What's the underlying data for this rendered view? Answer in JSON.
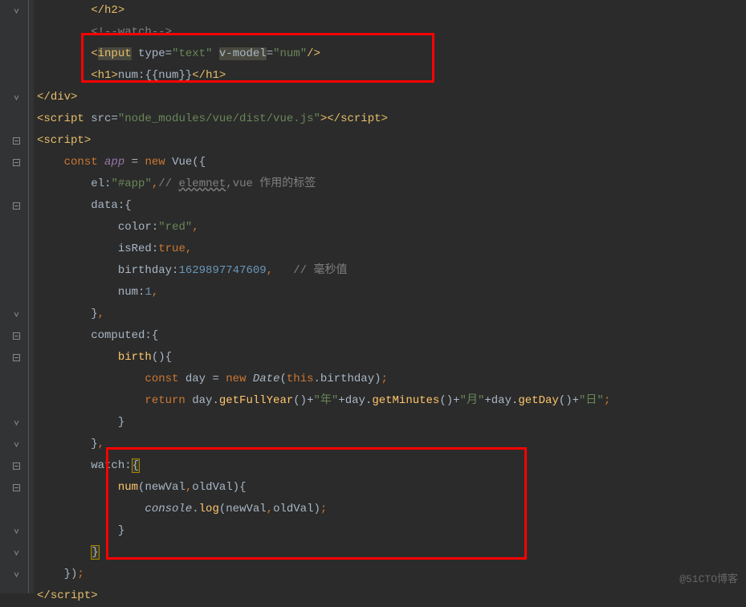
{
  "watermark": "@51CTO博客",
  "lines": [
    {
      "indent": 2,
      "tokens": [
        {
          "t": "</",
          "c": "tag"
        },
        {
          "t": "h2",
          "c": "tag"
        },
        {
          "t": ">",
          "c": "tag"
        }
      ]
    },
    {
      "indent": 2,
      "tokens": [
        {
          "t": "<!--watch-->",
          "c": "comment"
        }
      ]
    },
    {
      "indent": 2,
      "tokens": [
        {
          "t": "<",
          "c": "tag"
        },
        {
          "t": "input",
          "c": "tag hl1"
        },
        {
          "t": " ",
          "c": ""
        },
        {
          "t": "type=",
          "c": "attr"
        },
        {
          "t": "\"text\"",
          "c": "string"
        },
        {
          "t": " ",
          "c": ""
        },
        {
          "t": "v-model",
          "c": "attr hl1"
        },
        {
          "t": "=",
          "c": "attr"
        },
        {
          "t": "\"num\"",
          "c": "string"
        },
        {
          "t": "/>",
          "c": "tag"
        }
      ]
    },
    {
      "indent": 2,
      "tokens": [
        {
          "t": "<",
          "c": "tag"
        },
        {
          "t": "h1",
          "c": "tag"
        },
        {
          "t": ">",
          "c": "tag"
        },
        {
          "t": "num:{{num}}",
          "c": "text"
        },
        {
          "t": "</",
          "c": "tag"
        },
        {
          "t": "h1",
          "c": "tag"
        },
        {
          "t": ">",
          "c": "tag"
        }
      ]
    },
    {
      "indent": 0,
      "tokens": [
        {
          "t": "</",
          "c": "tag"
        },
        {
          "t": "div",
          "c": "tag"
        },
        {
          "t": ">",
          "c": "tag"
        }
      ]
    },
    {
      "indent": 0,
      "tokens": [
        {
          "t": "<",
          "c": "tag"
        },
        {
          "t": "script ",
          "c": "tag"
        },
        {
          "t": "src=",
          "c": "attr"
        },
        {
          "t": "\"node_modules/vue/dist/vue.js\"",
          "c": "string"
        },
        {
          "t": "></",
          "c": "tag"
        },
        {
          "t": "script",
          "c": "tag"
        },
        {
          "t": ">",
          "c": "tag"
        }
      ]
    },
    {
      "indent": 0,
      "tokens": [
        {
          "t": "<",
          "c": "tag"
        },
        {
          "t": "script",
          "c": "tag"
        },
        {
          "t": ">",
          "c": "tag"
        }
      ]
    },
    {
      "indent": 1,
      "tokens": [
        {
          "t": "const ",
          "c": "keyword"
        },
        {
          "t": "app",
          "c": "italic-var"
        },
        {
          "t": " = ",
          "c": "punct"
        },
        {
          "t": "new ",
          "c": "keyword"
        },
        {
          "t": "Vue",
          "c": "text"
        },
        {
          "t": "({",
          "c": "punct"
        }
      ]
    },
    {
      "indent": 2,
      "tokens": [
        {
          "t": "el:",
          "c": "attr"
        },
        {
          "t": "\"#app\"",
          "c": "string"
        },
        {
          "t": ",",
          "c": "keyword"
        },
        {
          "t": "// ",
          "c": "comment"
        },
        {
          "t": "elemnet",
          "c": "comment underline"
        },
        {
          "t": ",vue 作用的标签",
          "c": "comment"
        }
      ]
    },
    {
      "indent": 2,
      "tokens": [
        {
          "t": "data:{",
          "c": "attr"
        }
      ]
    },
    {
      "indent": 3,
      "tokens": [
        {
          "t": "color:",
          "c": "attr"
        },
        {
          "t": "\"red\"",
          "c": "string"
        },
        {
          "t": ",",
          "c": "keyword"
        }
      ]
    },
    {
      "indent": 3,
      "tokens": [
        {
          "t": "isRed:",
          "c": "attr"
        },
        {
          "t": "true",
          "c": "keyword"
        },
        {
          "t": ",",
          "c": "keyword"
        }
      ]
    },
    {
      "indent": 3,
      "tokens": [
        {
          "t": "birthday:",
          "c": "attr"
        },
        {
          "t": "1629897747609",
          "c": "num"
        },
        {
          "t": ",",
          "c": "keyword"
        },
        {
          "t": "   // 毫秒值",
          "c": "comment"
        }
      ]
    },
    {
      "indent": 3,
      "tokens": [
        {
          "t": "num:",
          "c": "attr"
        },
        {
          "t": "1",
          "c": "num"
        },
        {
          "t": ",",
          "c": "keyword"
        }
      ]
    },
    {
      "indent": 2,
      "tokens": [
        {
          "t": "}",
          "c": "punct"
        },
        {
          "t": ",",
          "c": "keyword"
        }
      ]
    },
    {
      "indent": 2,
      "tokens": [
        {
          "t": "computed:{",
          "c": "attr"
        }
      ]
    },
    {
      "indent": 3,
      "tokens": [
        {
          "t": "birth",
          "c": "func"
        },
        {
          "t": "(){",
          "c": "punct"
        }
      ]
    },
    {
      "indent": 4,
      "tokens": [
        {
          "t": "const ",
          "c": "keyword"
        },
        {
          "t": "day = ",
          "c": "punct"
        },
        {
          "t": "new ",
          "c": "keyword"
        },
        {
          "t": "Date",
          "c": "type"
        },
        {
          "t": "(",
          "c": "punct"
        },
        {
          "t": "this",
          "c": "keyword"
        },
        {
          "t": ".birthday)",
          "c": "punct"
        },
        {
          "t": ";",
          "c": "keyword"
        }
      ]
    },
    {
      "indent": 4,
      "tokens": [
        {
          "t": "return ",
          "c": "keyword"
        },
        {
          "t": "day.",
          "c": "punct"
        },
        {
          "t": "getFullYear",
          "c": "func"
        },
        {
          "t": "()+",
          "c": "punct"
        },
        {
          "t": "\"年\"",
          "c": "string"
        },
        {
          "t": "+day.",
          "c": "punct"
        },
        {
          "t": "getMinutes",
          "c": "func"
        },
        {
          "t": "()+",
          "c": "punct"
        },
        {
          "t": "\"月\"",
          "c": "string"
        },
        {
          "t": "+day.",
          "c": "punct"
        },
        {
          "t": "getDay",
          "c": "func"
        },
        {
          "t": "()+",
          "c": "punct"
        },
        {
          "t": "\"日\"",
          "c": "string"
        },
        {
          "t": ";",
          "c": "keyword"
        }
      ]
    },
    {
      "indent": 3,
      "tokens": [
        {
          "t": "}",
          "c": "punct"
        }
      ]
    },
    {
      "indent": 2,
      "tokens": [
        {
          "t": "}",
          "c": "punct"
        },
        {
          "t": ",",
          "c": "keyword"
        }
      ]
    },
    {
      "indent": 2,
      "tokens": [
        {
          "t": "watch:",
          "c": "attr"
        },
        {
          "t": "{",
          "c": "punct brace-hl"
        }
      ]
    },
    {
      "indent": 3,
      "tokens": [
        {
          "t": "num",
          "c": "func"
        },
        {
          "t": "(newVal",
          "c": "punct"
        },
        {
          "t": ",",
          "c": "keyword"
        },
        {
          "t": "oldVal){",
          "c": "punct"
        }
      ]
    },
    {
      "indent": 4,
      "tokens": [
        {
          "t": "console",
          "c": "type"
        },
        {
          "t": ".",
          "c": "punct"
        },
        {
          "t": "log",
          "c": "func"
        },
        {
          "t": "(newVal",
          "c": "punct"
        },
        {
          "t": ",",
          "c": "keyword"
        },
        {
          "t": "oldVal)",
          "c": "punct"
        },
        {
          "t": ";",
          "c": "keyword"
        }
      ]
    },
    {
      "indent": 3,
      "tokens": [
        {
          "t": "}",
          "c": "punct"
        }
      ]
    },
    {
      "indent": 2,
      "tokens": [
        {
          "t": "}",
          "c": "punct brace-hl"
        }
      ]
    },
    {
      "indent": 1,
      "tokens": [
        {
          "t": "})",
          "c": "punct"
        },
        {
          "t": ";",
          "c": "keyword"
        }
      ]
    },
    {
      "indent": 0,
      "tokens": [
        {
          "t": "</",
          "c": "tag"
        },
        {
          "t": "script",
          "c": "tag"
        },
        {
          "t": ">",
          "c": "tag"
        }
      ]
    }
  ],
  "gutter_marks": [
    "close",
    "",
    "",
    "",
    "close",
    "",
    "open",
    "open",
    "",
    "open",
    "",
    "",
    "",
    "",
    "close",
    "open",
    "open",
    "",
    "",
    "close",
    "close",
    "open",
    "open",
    "",
    "close",
    "close",
    "close",
    ""
  ]
}
